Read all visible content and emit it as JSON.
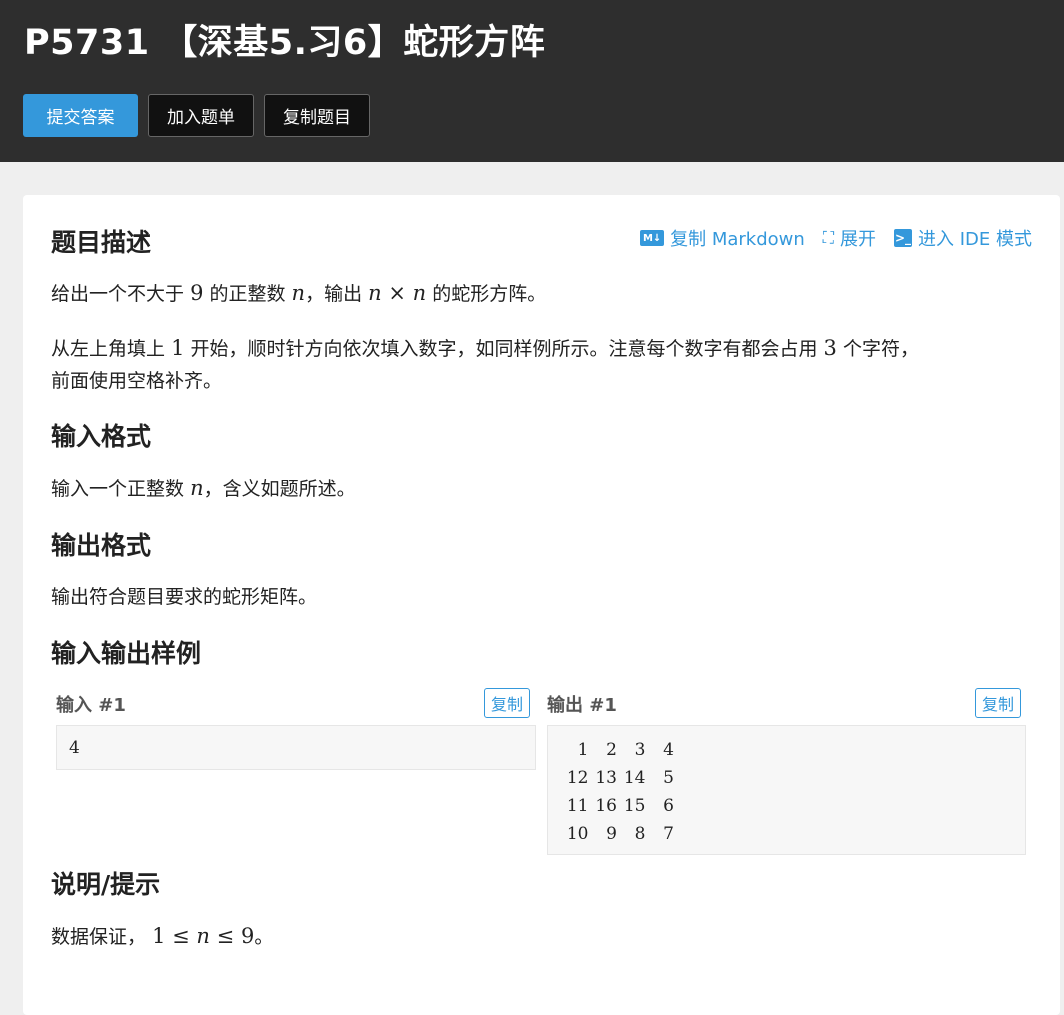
{
  "header": {
    "title": "P5731 【深基5.习6】蛇形方阵",
    "buttons": [
      "提交答案",
      "加入题单",
      "复制题目"
    ]
  },
  "toolbar": {
    "copy_markdown": "复制 Markdown",
    "expand": "展开",
    "ide_mode": "进入 IDE 模式"
  },
  "description": {
    "title": "题目描述",
    "p1_a": "给出一个不大于",
    "p1_num": "9",
    "p1_b": "的正整数",
    "p1_var": "n",
    "p1_c": "，输出",
    "p1_expr_n1": "n",
    "p1_expr_times": "×",
    "p1_expr_n2": "n",
    "p1_d": "的蛇形方阵。",
    "p2_a": "从左上角填上",
    "p2_num1": "1",
    "p2_b": "开始，顺时针方向依次填入数字，如同样例所示。注意每个数字有都会占用",
    "p2_num2": "3",
    "p2_c": "个字符，",
    "p2_line2": "前面使用空格补齐。"
  },
  "input_format": {
    "title": "输入格式",
    "text_a": "输入一个正整数",
    "var": "n",
    "text_b": "，含义如题所述。"
  },
  "output_format": {
    "title": "输出格式",
    "text": "输出符合题目要求的蛇形矩阵。"
  },
  "samples": {
    "title": "输入输出样例",
    "input_label": "输入 #1",
    "output_label": "输出 #1",
    "copy_label": "复制",
    "input_value": "4",
    "output_rows": [
      [
        "1",
        "2",
        "3",
        "4"
      ],
      [
        "12",
        "13",
        "14",
        "5"
      ],
      [
        "11",
        "16",
        "15",
        "6"
      ],
      [
        "10",
        "9",
        "8",
        "7"
      ]
    ]
  },
  "hint": {
    "title": "说明/提示",
    "text_a": "数据保证，",
    "expr_1": "1",
    "expr_le1": "≤",
    "expr_n": "n",
    "expr_le2": "≤",
    "expr_9": "9",
    "text_b": "。"
  },
  "colors": {
    "header_bg": "#2e2e2e",
    "accent": "#3498db",
    "page_bg": "#efefef"
  }
}
